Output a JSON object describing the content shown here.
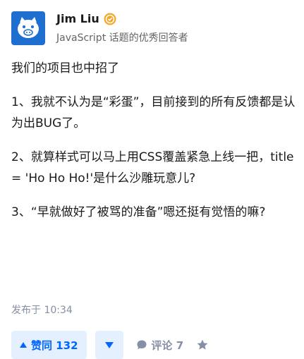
{
  "author": {
    "name": "Jim Liu",
    "description": "JavaScript 话题的优秀回答者",
    "avatar_icon": "pig-avatar-icon",
    "badge_icon": "excellent-answerer-badge-icon",
    "badge_color": "#f5a623"
  },
  "content": {
    "paragraphs": [
      "我们的项目也中招了",
      "1、我就不认为是“彩蛋”，目前接到的所有反馈都是认为出BUG了。",
      "2、就算样式可以马上用CSS覆盖紧急上线一把，title = 'Ho Ho Ho!'是什么沙雕玩意儿?",
      "3、“早就做好了被骂的准备”嗯还挺有觉悟的嘛?"
    ]
  },
  "meta": {
    "publish_time": "发布于 10:34"
  },
  "actions": {
    "vote_up_label": "赞同 132",
    "comment_label": "评论 7",
    "accent_color": "#0066ff"
  }
}
